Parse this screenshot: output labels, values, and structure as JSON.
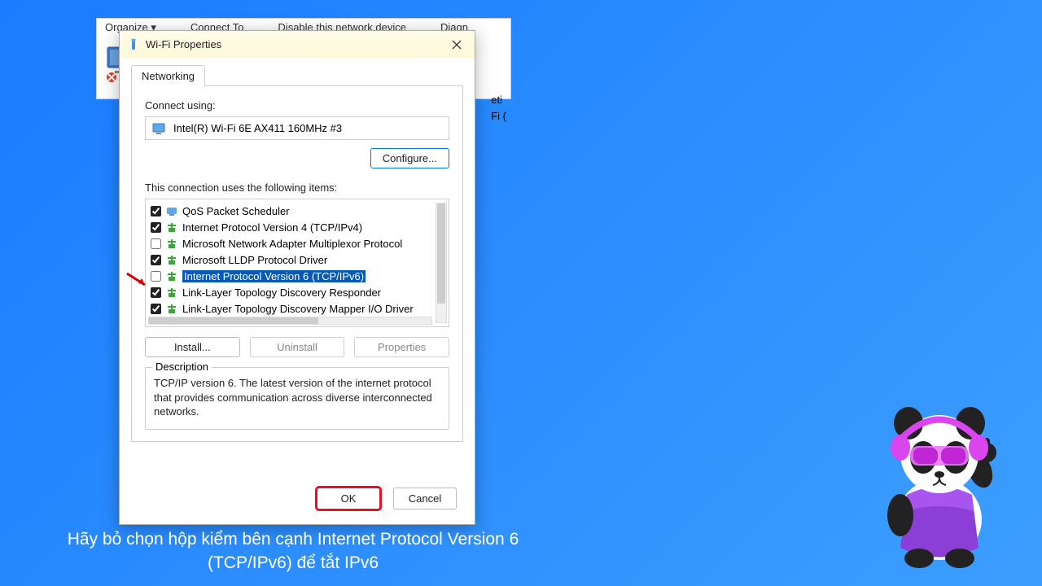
{
  "parent": {
    "toolbar": [
      "Organize ▾",
      "Connect To",
      "Disable this network device",
      "Diagn"
    ],
    "right_snippets": [
      "eti",
      "Fi ("
    ]
  },
  "dialog": {
    "title": "Wi-Fi Properties",
    "tab": "Networking",
    "connect_label": "Connect using:",
    "adapter": "Intel(R) Wi-Fi 6E AX411 160MHz #3",
    "configure_btn": "Configure...",
    "items_label": "This connection uses the following items:",
    "items": [
      {
        "checked": true,
        "icon": "net",
        "label": "QoS Packet Scheduler",
        "selected": false
      },
      {
        "checked": true,
        "icon": "proto",
        "label": "Internet Protocol Version 4 (TCP/IPv4)",
        "selected": false
      },
      {
        "checked": false,
        "icon": "proto",
        "label": "Microsoft Network Adapter Multiplexor Protocol",
        "selected": false
      },
      {
        "checked": true,
        "icon": "proto",
        "label": "Microsoft LLDP Protocol Driver",
        "selected": false
      },
      {
        "checked": false,
        "icon": "proto",
        "label": "Internet Protocol Version 6 (TCP/IPv6)",
        "selected": true
      },
      {
        "checked": true,
        "icon": "proto",
        "label": "Link-Layer Topology Discovery Responder",
        "selected": false
      },
      {
        "checked": true,
        "icon": "proto",
        "label": "Link-Layer Topology Discovery Mapper I/O Driver",
        "selected": false
      }
    ],
    "install_btn": "Install...",
    "uninstall_btn": "Uninstall",
    "properties_btn": "Properties",
    "desc_legend": "Description",
    "desc_text": "TCP/IP version 6. The latest version of the internet protocol that provides communication across diverse interconnected networks.",
    "ok_btn": "OK",
    "cancel_btn": "Cancel"
  },
  "caption": "Hãy bỏ chọn hộp kiểm bên cạnh Internet Protocol Version 6 (TCP/IPv6) để tắt IPv6",
  "annotations": {
    "arrow_target": "ipv6-checkbox",
    "ok_highlighted": true
  }
}
